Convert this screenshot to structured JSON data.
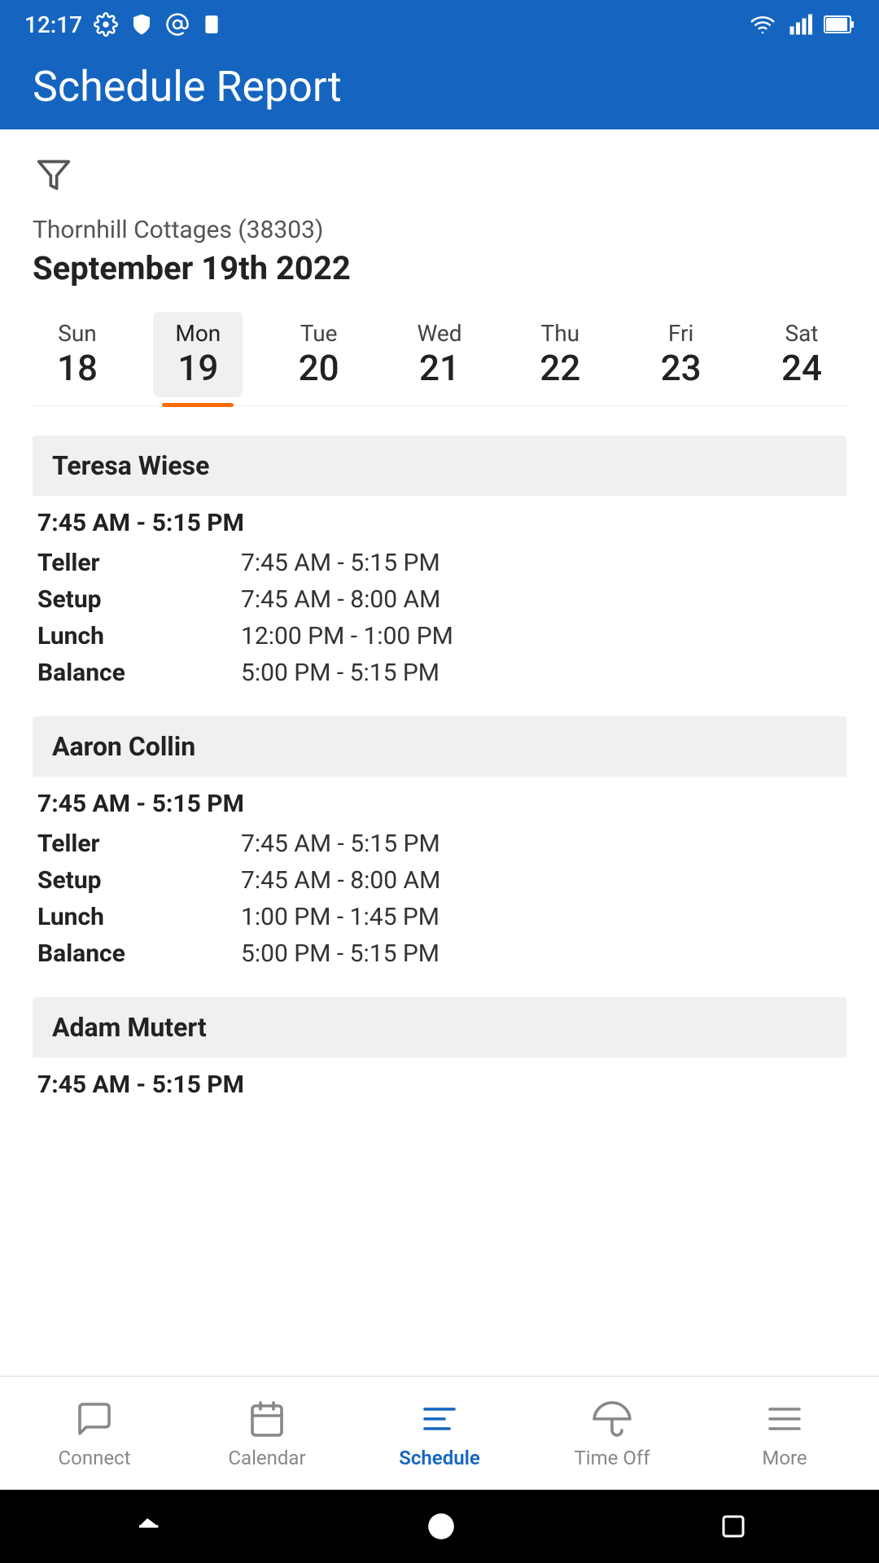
{
  "statusBar": {
    "time": "12:17"
  },
  "header": {
    "title": "Schedule Report"
  },
  "content": {
    "location": "Thornhill Cottages (38303)",
    "date": "September 19th 2022",
    "weekDays": [
      {
        "name": "Sun",
        "number": "18",
        "active": false
      },
      {
        "name": "Mon",
        "number": "19",
        "active": true
      },
      {
        "name": "Tue",
        "number": "20",
        "active": false
      },
      {
        "name": "Wed",
        "number": "21",
        "active": false
      },
      {
        "name": "Thu",
        "number": "22",
        "active": false
      },
      {
        "name": "Fri",
        "number": "23",
        "active": false
      },
      {
        "name": "Sat",
        "number": "24",
        "active": false
      }
    ],
    "employees": [
      {
        "name": "Teresa Wiese",
        "summary": "7:45 AM - 5:15 PM",
        "shifts": [
          {
            "label": "Teller",
            "time": "7:45 AM - 5:15 PM"
          },
          {
            "label": "Setup",
            "time": "7:45 AM - 8:00 AM"
          },
          {
            "label": "Lunch",
            "time": "12:00 PM - 1:00 PM"
          },
          {
            "label": "Balance",
            "time": "5:00 PM - 5:15 PM"
          }
        ]
      },
      {
        "name": "Aaron Collin",
        "summary": "7:45 AM - 5:15 PM",
        "shifts": [
          {
            "label": "Teller",
            "time": "7:45 AM - 5:15 PM"
          },
          {
            "label": "Setup",
            "time": "7:45 AM - 8:00 AM"
          },
          {
            "label": "Lunch",
            "time": "1:00 PM - 1:45 PM"
          },
          {
            "label": "Balance",
            "time": "5:00 PM - 5:15 PM"
          }
        ]
      },
      {
        "name": "Adam Mutert",
        "summary": "7:45 AM - 5:15 PM",
        "shifts": []
      }
    ]
  },
  "bottomNav": {
    "items": [
      {
        "label": "Connect",
        "active": false
      },
      {
        "label": "Calendar",
        "active": false
      },
      {
        "label": "Schedule",
        "active": true
      },
      {
        "label": "Time Off",
        "active": false
      },
      {
        "label": "More",
        "active": false
      }
    ]
  }
}
